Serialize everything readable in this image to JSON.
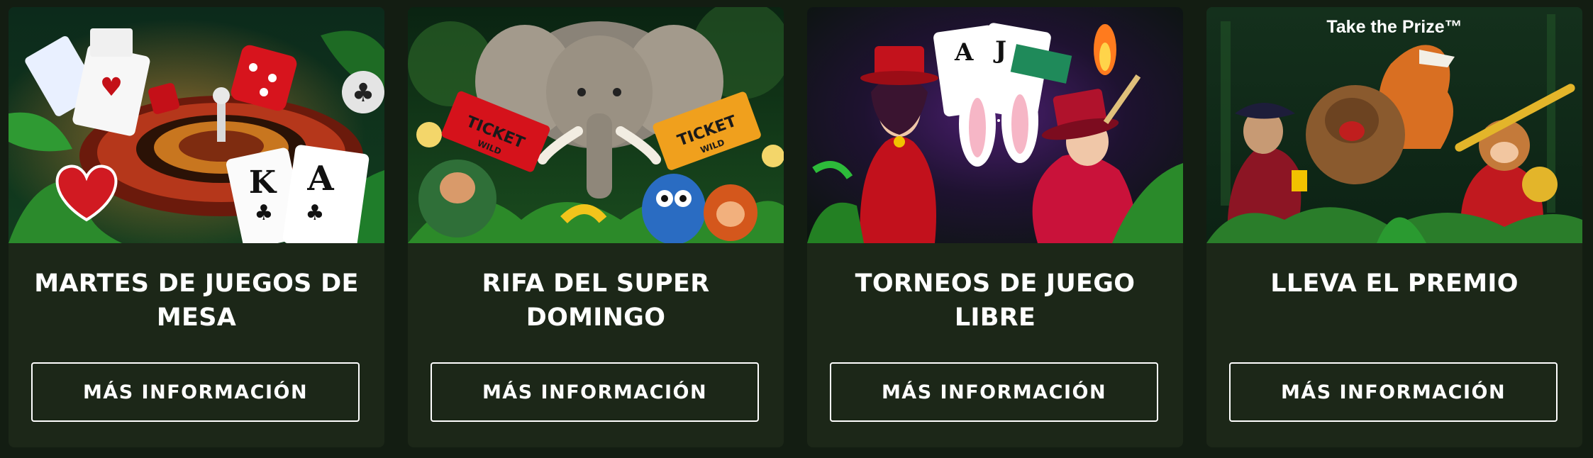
{
  "promotions": [
    {
      "title": "MARTES DE JUEGOS DE MESA",
      "button_label": "MÁS INFORMACIÓN",
      "image": "roulette-dice-playing-cards-jungle",
      "card_labels": [
        "K",
        "A"
      ]
    },
    {
      "title": "RIFA DEL SUPER DOMINGO",
      "button_label": "MÁS INFORMACIÓN",
      "image": "elephant-monkeys-raffle-tickets-jungle",
      "ticket_labels": [
        "TICKET",
        "TICKET"
      ],
      "ticket_sub": "WILD"
    },
    {
      "title": "TORNEOS DE JUEGO LIBRE",
      "button_label": "MÁS INFORMACIÓN",
      "image": "magician-showgirl-fire-cards",
      "card_labels": [
        "A",
        "J"
      ]
    },
    {
      "title": "LLEVA EL PREMIO",
      "button_label": "MÁS INFORMACIÓN",
      "image": "take-the-prize-adventure-characters",
      "logo_text": "Take the Prize™"
    }
  ],
  "colors": {
    "page_bg": "#131d12",
    "card_bg": "#1c2718",
    "text": "#ffffff"
  }
}
